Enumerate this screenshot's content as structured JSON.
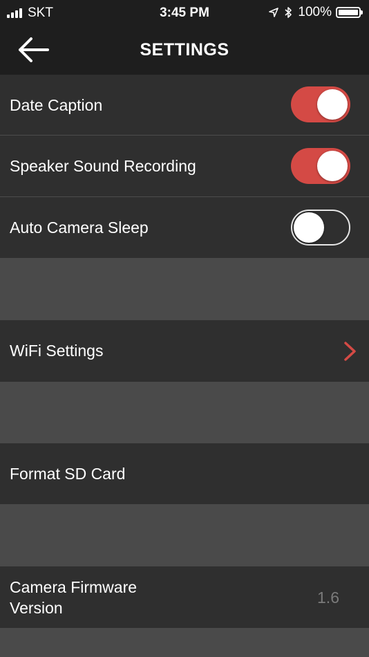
{
  "status": {
    "carrier": "SKT",
    "time": "3:45 PM",
    "battery": "100%"
  },
  "nav": {
    "title": "SETTINGS",
    "back_icon": "back-arrow-icon"
  },
  "settings": {
    "date_caption": {
      "label": "Date Caption",
      "enabled": true
    },
    "speaker_sound": {
      "label": "Speaker Sound Recording",
      "enabled": true
    },
    "auto_sleep": {
      "label": "Auto Camera Sleep",
      "enabled": false
    },
    "wifi": {
      "label": "WiFi Settings"
    },
    "format_sd": {
      "label": "Format SD Card"
    },
    "firmware": {
      "label_line1": "Camera Firmware",
      "label_line2": "Version",
      "value": "1.6"
    }
  },
  "colors": {
    "accent": "#d44a45",
    "row_bg": "#2f2f2f",
    "separator_bg": "#4a4a4a",
    "bar_bg": "#1e1e1e"
  }
}
